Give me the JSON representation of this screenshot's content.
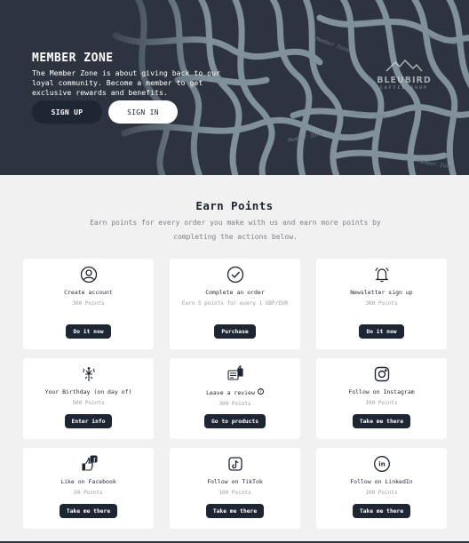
{
  "hero": {
    "title": "MEMBER ZONE",
    "description": "The Member Zone is about giving back to our loyal community. Become a member to get exclusive rewards and benefits.",
    "signup_label": "SIGN UP",
    "signin_label": "SIGN IN",
    "brand_name": "BLEUBIRD",
    "brand_sub": "COFFEE  SHOP",
    "pattern_text": "Member Zone"
  },
  "earn": {
    "title": "Earn Points",
    "subtitle": "Earn points for every order you make with us and earn more points by completing the actions below."
  },
  "cards": [
    {
      "icon": "user-icon",
      "title": "Create account",
      "points": "300 Points",
      "action": "Do it now"
    },
    {
      "icon": "check-circle-icon",
      "title": "Complete an order",
      "points": "Earn 5 points for every 1 GBP/EUR",
      "action": "Purchase"
    },
    {
      "icon": "bell-icon",
      "title": "Newsletter sign up",
      "points": "300 Points",
      "action": "Do it now"
    },
    {
      "icon": "fireworks-icon",
      "title": "Your Birthday (on day of)",
      "points": "500 Points",
      "action": "Enter info"
    },
    {
      "icon": "review-icon",
      "title": "Leave a review",
      "points": "300 Points",
      "action": "Go to products"
    },
    {
      "icon": "instagram-icon",
      "title": "Follow on Instagram",
      "points": "100 Points",
      "action": "Take me there"
    },
    {
      "icon": "facebook-like-icon",
      "title": "Like on Facebook",
      "points": "50 Points",
      "action": "Take me there"
    },
    {
      "icon": "tiktok-icon",
      "title": "Follow on TikTok",
      "points": "100 Points",
      "action": "Take me there"
    },
    {
      "icon": "linkedin-icon",
      "title": "Follow on LinkedIn",
      "points": "100 Points",
      "action": "Take me there"
    }
  ],
  "colors": {
    "hero_bg": "#2d3440",
    "button_dark": "#1f2633",
    "page_bg": "#f1f1f1"
  }
}
